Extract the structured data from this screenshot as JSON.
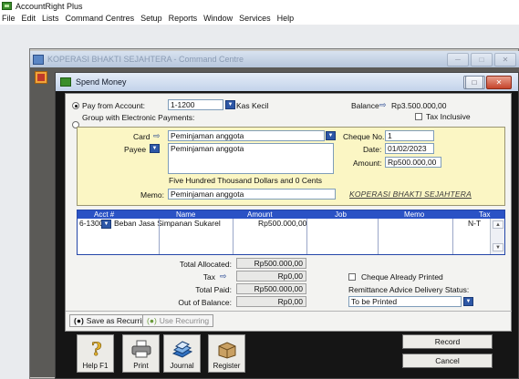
{
  "app": {
    "title": "AccountRight Plus",
    "menu": [
      "File",
      "Edit",
      "Lists",
      "Command Centres",
      "Setup",
      "Reports",
      "Window",
      "Services",
      "Help"
    ]
  },
  "command_centre": {
    "title": "KOPERASI BHAKTI SEJAHTERA - Command Centre"
  },
  "spend_money": {
    "title": "Spend Money",
    "pay_from_label": "Pay from Account:",
    "pay_from_account": "1-1200",
    "pay_from_name": "Kas Kecil",
    "group_label": "Group with Electronic Payments:",
    "balance_label": "Balance",
    "balance_value": "Rp3.500.000,00",
    "tax_inclusive_label": "Tax Inclusive",
    "card_label": "Card",
    "card_value": "Peminjaman anggota",
    "payee_label": "Payee",
    "payee_value": "Peminjaman anggota",
    "amount_in_words": "Five Hundred Thousand Dollars and 0 Cents",
    "memo_label": "Memo:",
    "memo_value": "Peminjaman anggota",
    "cheque_no_label": "Cheque No.:",
    "cheque_no_value": "1",
    "date_label": "Date:",
    "date_value": "01/02/2023",
    "amount_label": "Amount:",
    "amount_value": "Rp500.000,00",
    "company_name": "KOPERASI BHAKTI SEJAHTERA"
  },
  "grid": {
    "headers": [
      "Acct #",
      "Name",
      "Amount",
      "Job",
      "Memo",
      "Tax"
    ],
    "rows": [
      {
        "acct": "6-1300",
        "name": "Beban Jasa Simpanan Sukarel",
        "amount": "Rp500.000,00",
        "job": "",
        "memo": "",
        "tax": "N-T"
      }
    ]
  },
  "totals": {
    "allocated_label": "Total Allocated:",
    "allocated_value": "Rp500.000,00",
    "tax_label": "Tax",
    "tax_value": "Rp0,00",
    "paid_label": "Total Paid:",
    "paid_value": "Rp500.000,00",
    "out_label": "Out of Balance:",
    "out_value": "Rp0,00",
    "cheque_printed_label": "Cheque Already Printed",
    "remittance_label": "Remittance Advice Delivery Status:",
    "remittance_value": "To be Printed"
  },
  "recurring": {
    "save_label": "Save as Recurring",
    "use_label": "Use Recurring"
  },
  "toolbar": {
    "help_label": "Help F1",
    "print_label": "Print",
    "journal_label": "Journal",
    "register_label": "Register",
    "record_label": "Record",
    "cancel_label": "Cancel"
  },
  "colors": {
    "grid_header": "#2a52c5",
    "cheque_bg": "#fbf6c4",
    "window_title": "#c3d3ea"
  }
}
